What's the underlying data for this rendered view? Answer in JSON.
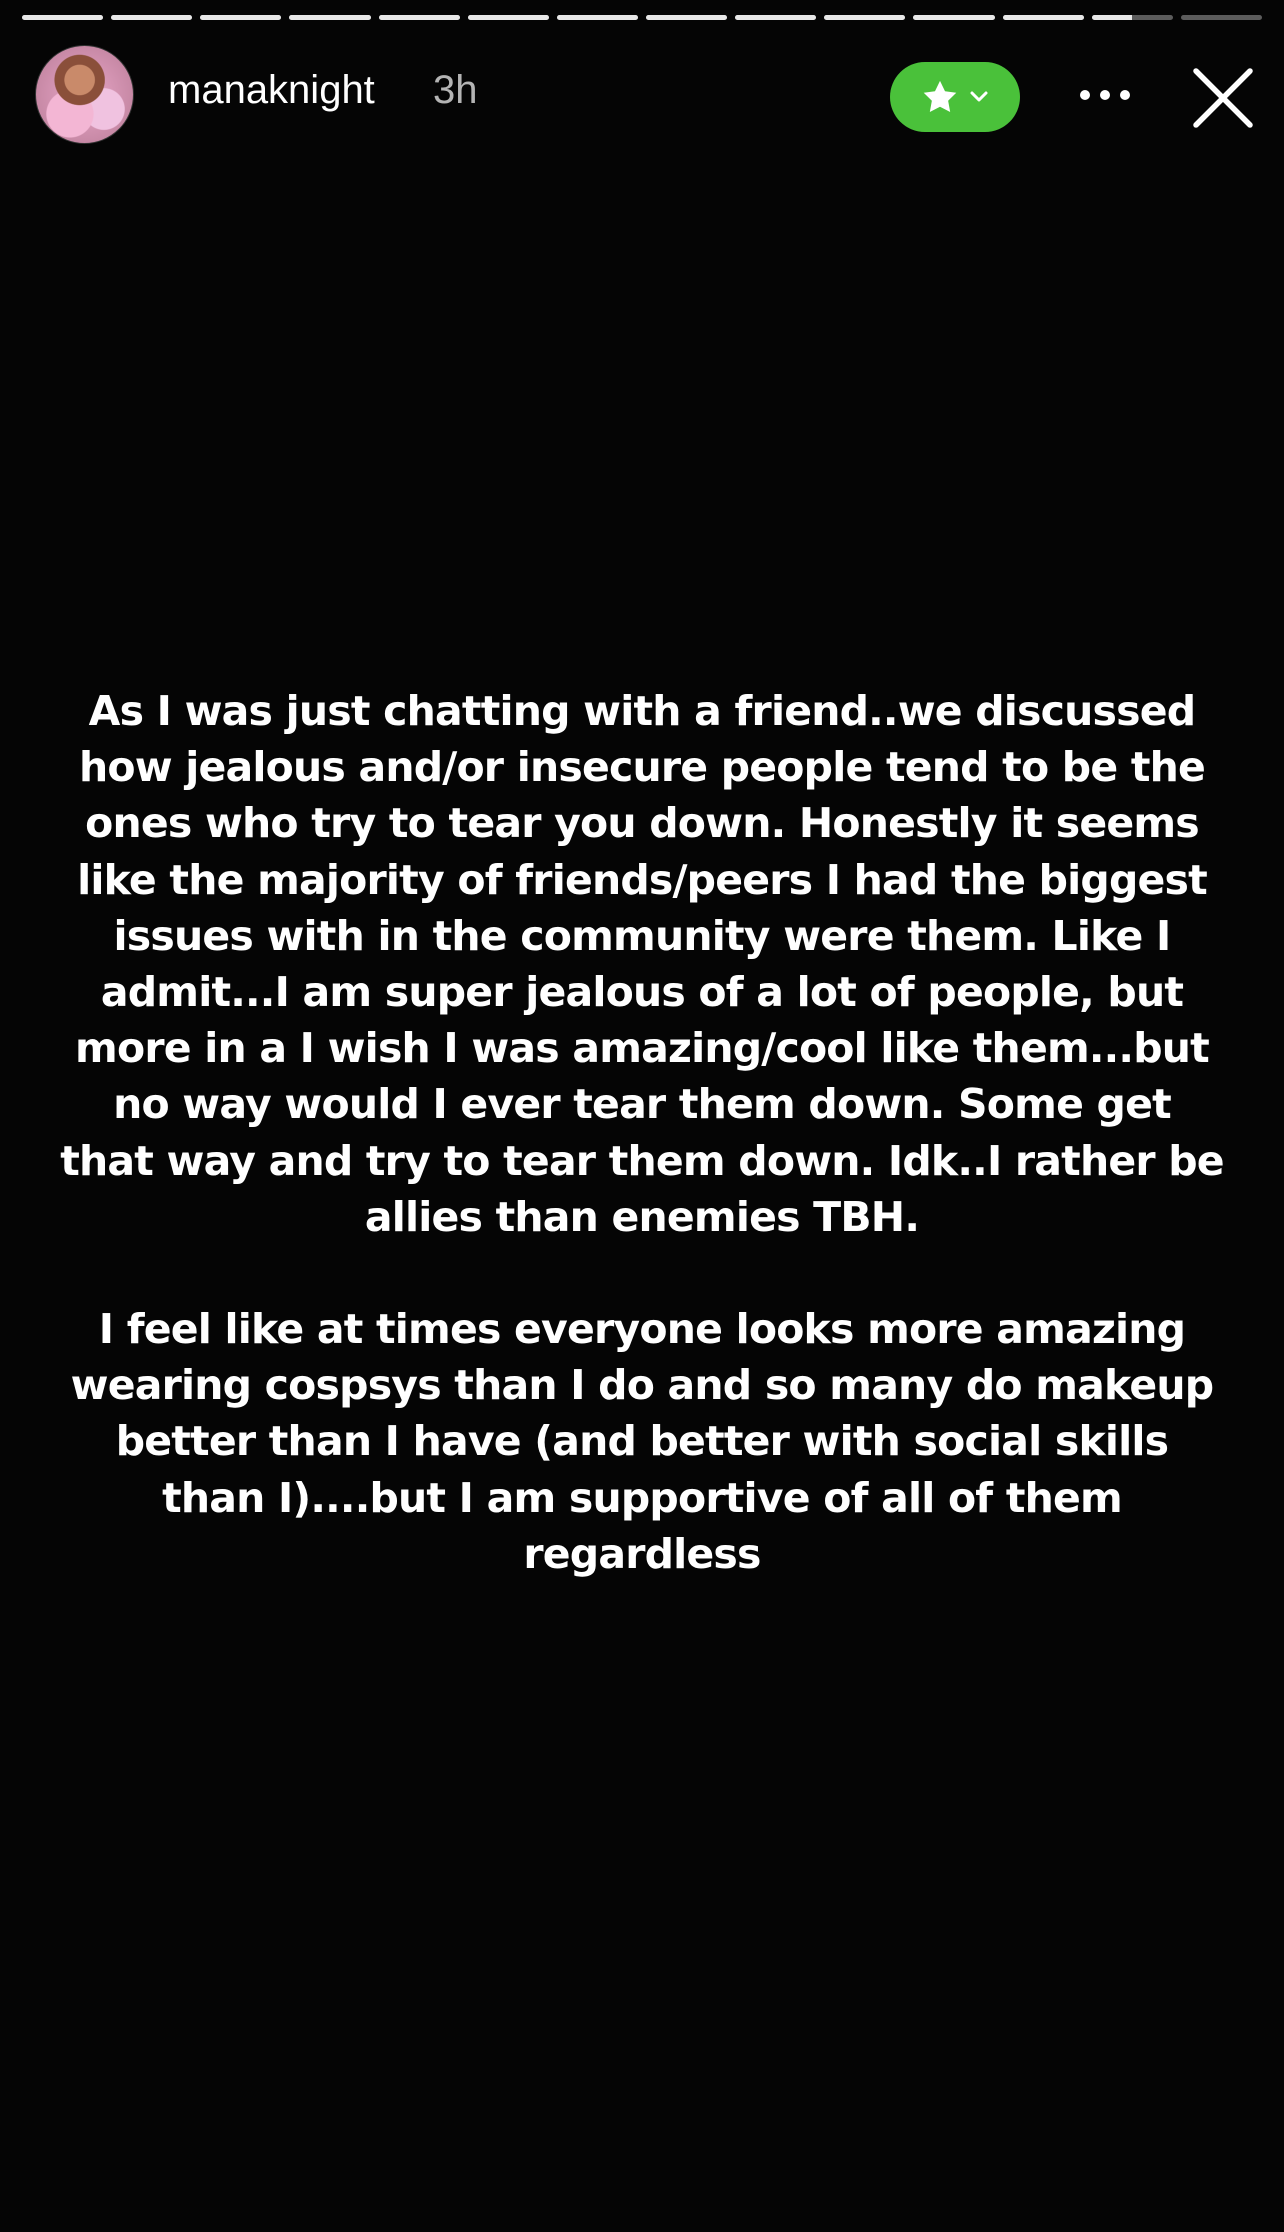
{
  "story": {
    "progress": {
      "segment_count": 14,
      "completed_segments": 12,
      "current_segment_progress": 0.5
    },
    "header": {
      "username": "manaknight",
      "time_ago": "3h",
      "close_friends_icon": "star-icon",
      "close_friends_color": "#4ac13a",
      "more_icon": "more-horizontal-icon",
      "close_icon": "close-icon"
    },
    "text": {
      "paragraph_1": "As I was just chatting with a friend..we discussed how jealous and/or insecure people tend to be the ones who try to tear you down. Honestly it seems like the majority of friends/peers I had the biggest issues with in the community were them. Like I admit...I am super jealous of a lot of people, but more in a I wish I was amazing/cool like them...but no way would I ever tear them down. Some get that way and try to tear them down. Idk..I rather be allies than enemies TBH.",
      "paragraph_2": "I feel like at times everyone looks more amazing wearing cospsys than I do and so many do makeup better than I have (and better with social skills than I)....but I am supportive of all of them regardless"
    }
  }
}
